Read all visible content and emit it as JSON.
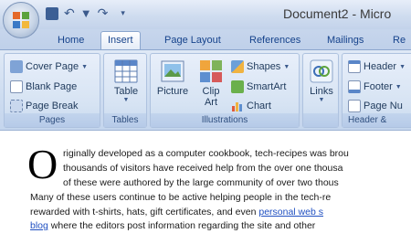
{
  "window": {
    "title": "Document2 - Micro"
  },
  "qat": {
    "save_icon": "save-icon",
    "undo_icon": "undo-icon",
    "redo_icon": "redo-icon",
    "customize_icon": "customize-qat-icon"
  },
  "tabs": [
    {
      "label": "Home"
    },
    {
      "label": "Insert"
    },
    {
      "label": "Page Layout"
    },
    {
      "label": "References"
    },
    {
      "label": "Mailings"
    },
    {
      "label": "Re"
    }
  ],
  "ribbon": {
    "pages": {
      "label": "Pages",
      "cover_page": "Cover Page",
      "blank_page": "Blank Page",
      "page_break": "Page Break"
    },
    "tables": {
      "label": "Tables",
      "table": "Table"
    },
    "illustrations": {
      "label": "Illustrations",
      "picture": "Picture",
      "clip_art_1": "Clip",
      "clip_art_2": "Art",
      "shapes": "Shapes",
      "smartart": "SmartArt",
      "chart": "Chart"
    },
    "links": {
      "label": "",
      "links": "Links"
    },
    "header_footer": {
      "label": "Header &",
      "header": "Header",
      "footer": "Footer",
      "page_number": "Page Nu"
    }
  },
  "document": {
    "dropcap": "O",
    "lines": [
      "riginally developed as a computer cookbook, tech-recipes was brou",
      "thousands of visitors have received help from the over one thousa",
      "of these were authored by the large community of over two thous",
      "Many of these users continue to be active helping people in the tech-re",
      "rewarded with t-shirts, hats, gift certificates, and even ",
      "blog",
      " where the editors post information regarding the site and other"
    ],
    "link1": "personal web s",
    "colors": {
      "link": "#1f4fc1",
      "ribbon": "#cddcf0"
    }
  }
}
